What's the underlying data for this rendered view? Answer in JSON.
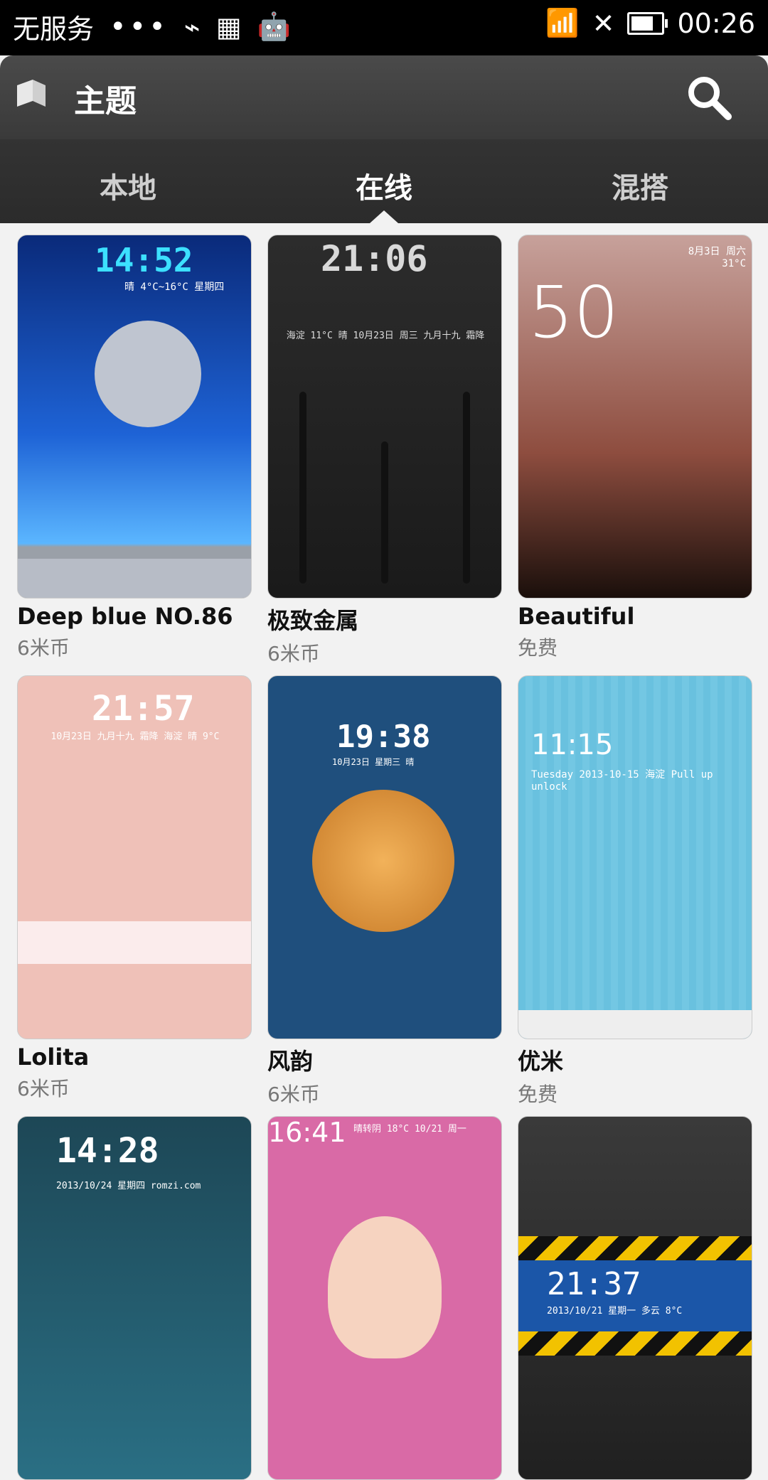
{
  "statusbar": {
    "carrier": "无服务",
    "time": "00:26"
  },
  "header": {
    "title": "主题",
    "search_icon": "search-icon",
    "app_icon": "themes-book-icon"
  },
  "tabs": [
    {
      "label": "本地"
    },
    {
      "label": "在线"
    },
    {
      "label": "混搭"
    }
  ],
  "themes": [
    {
      "name": "Deep blue NO.86",
      "price": "6米币",
      "preview_time": "14:52",
      "preview_extra": "晴 4°C~16°C 星期四"
    },
    {
      "name": "极致金属",
      "price": "6米币",
      "preview_time": "21:06",
      "preview_extra": "海淀 11°C 晴 10月23日 周三 九月十九 霜降"
    },
    {
      "name": "Beautiful",
      "price": "免费",
      "preview_time": "50",
      "preview_extra": "8月3日 周六 31°C"
    },
    {
      "name": "Lolita",
      "price": "6米币",
      "preview_time": "21:57",
      "preview_extra": "10月23日 九月十九 霜降 海淀 晴 9°C"
    },
    {
      "name": "风韵",
      "price": "6米币",
      "preview_time": "19:38",
      "preview_extra": "10月23日 星期三 晴"
    },
    {
      "name": "优米",
      "price": "免费",
      "preview_time": "11:15",
      "preview_extra": "Tuesday 2013-10-15 海淀 Pull up unlock"
    },
    {
      "name": "",
      "price": "",
      "preview_time": "14:28",
      "preview_extra": "2013/10/24 星期四 romzi.com"
    },
    {
      "name": "",
      "price": "",
      "preview_time": "16:41",
      "preview_extra": "晴转阴 18°C 10/21 周一"
    },
    {
      "name": "",
      "price": "",
      "preview_time": "21:37",
      "preview_extra": "2013/10/21 星期一 多云 8°C"
    }
  ]
}
